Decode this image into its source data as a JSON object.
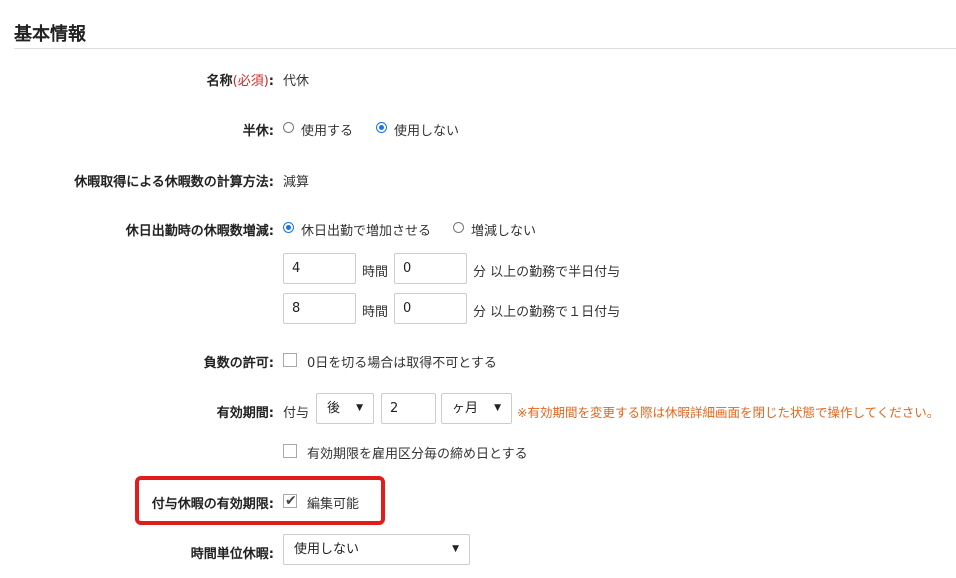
{
  "section": {
    "title": "基本情報"
  },
  "name_row": {
    "label": "名称",
    "required": "(必須)",
    "colon": ":",
    "value": "代休"
  },
  "half_day": {
    "label": "半休:",
    "options": [
      "使用する",
      "使用しない"
    ],
    "selected": 1
  },
  "calc_method": {
    "label": "休暇取得による休暇数の計算方法:",
    "value": "減算"
  },
  "holiday_work": {
    "label": "休日出勤時の休暇数増減:",
    "options": [
      "休日出勤で増加させる",
      "増減しない"
    ],
    "selected": 0,
    "row1": {
      "hours": "4",
      "hours_unit": "時間",
      "minutes": "0",
      "minutes_suffix": "分 以上の勤務で半日付与"
    },
    "row2": {
      "hours": "8",
      "hours_unit": "時間",
      "minutes": "0",
      "minutes_suffix": "分 以上の勤務で１日付与"
    }
  },
  "negative": {
    "label": "負数の許可:",
    "checkbox_label": "0日を切る場合は取得不可とする",
    "checked": false
  },
  "validity": {
    "label": "有効期間:",
    "prefix": "付与",
    "timing_select": "後",
    "amount": "2",
    "unit_select": "ヶ月",
    "warning": "※有効期間を変更する際は休暇詳細画面を閉じた状態で操作してください。",
    "closing_checkbox_label": "有効期限を雇用区分毎の締め日とする",
    "closing_checked": false
  },
  "granted_validity": {
    "label": "付与休暇の有効期限:",
    "checkbox_label": "編集可能",
    "checked": true
  },
  "hourly_leave": {
    "label": "時間単位休暇:",
    "select_value": "使用しない"
  },
  "colors": {
    "highlight": "#e21b1b",
    "warning": "#e8641a",
    "required": "#cc2a2a",
    "radio_accent": "#1a73e8"
  }
}
